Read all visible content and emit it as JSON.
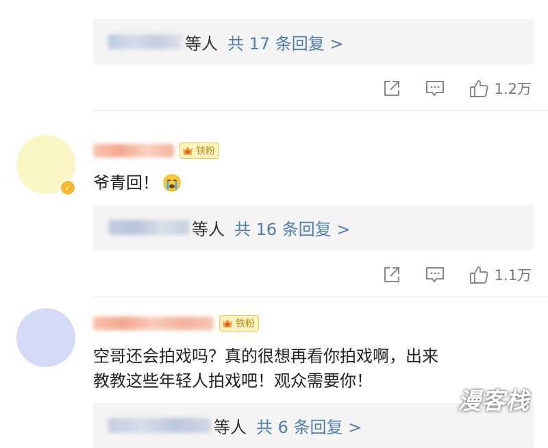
{
  "comments": [
    {
      "reply_box": {
        "et_al": "等人",
        "count_text": "共 17 条回复 >"
      },
      "actions": {
        "share_icon": "share-icon",
        "comment_icon": "comment-icon",
        "like_icon": "thumbs-up-icon",
        "likes": "1.2万"
      }
    },
    {
      "fan_badge": "铁粉",
      "text": "爷青回！",
      "emoji": "loudly-crying-face",
      "reply_box": {
        "et_al": "等人",
        "count_text": "共 16 条回复 >"
      },
      "actions": {
        "share_icon": "share-icon",
        "comment_icon": "comment-icon",
        "like_icon": "thumbs-up-icon",
        "likes": "1.1万"
      }
    },
    {
      "fan_badge": "铁粉",
      "text_line1": "空哥还会拍戏吗？真的很想再看你拍戏啊，出来",
      "text_line2": "教教这些年轻人拍戏吧！观众需要你！",
      "reply_box": {
        "et_al": "等人",
        "count_text": "共 6 条回复 >"
      }
    }
  ],
  "watermark": "漫客栈",
  "colors": {
    "link": "#507daf",
    "badge_gold": "#f5b82e",
    "avatar1": "#fbf4c4",
    "avatar2": "#d2daf6"
  }
}
